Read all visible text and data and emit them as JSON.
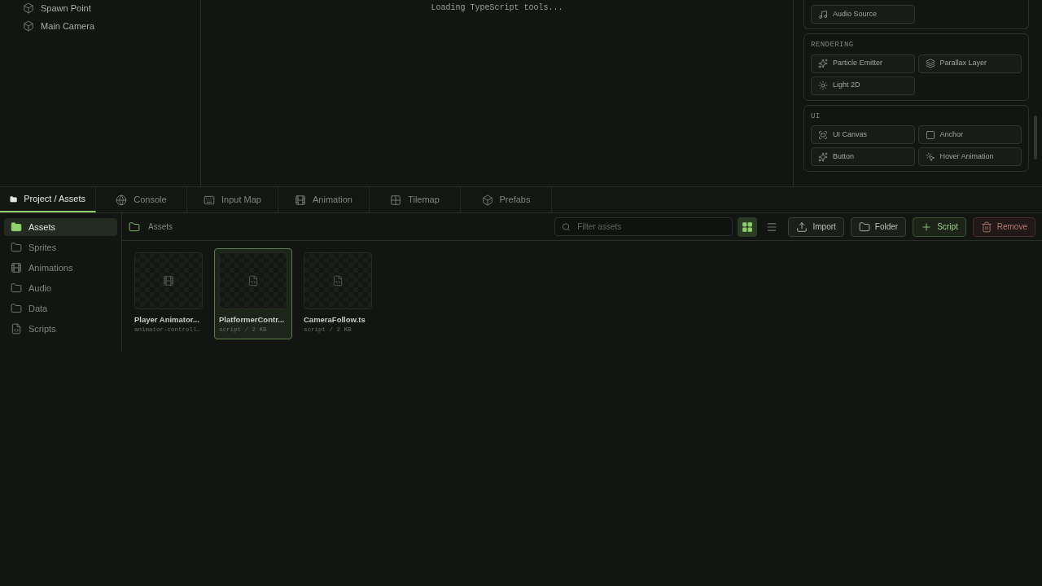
{
  "hierarchy": {
    "items": [
      "Spawn Point",
      "Main Camera"
    ]
  },
  "viewport": {
    "status": "Loading TypeScript tools..."
  },
  "components": {
    "sections": [
      {
        "items": [
          {
            "label": "Audio Source"
          }
        ]
      },
      {
        "title": "RENDERING",
        "items": [
          {
            "label": "Particle Emitter"
          },
          {
            "label": "Parallax Layer"
          },
          {
            "label": "Light 2D"
          }
        ]
      },
      {
        "title": "UI",
        "items": [
          {
            "label": "UI Canvas"
          },
          {
            "label": "Anchor"
          },
          {
            "label": "Button"
          },
          {
            "label": "Hover Animation"
          }
        ]
      }
    ]
  },
  "tabs": [
    {
      "label": "Project / Assets",
      "selected": true
    },
    {
      "label": "Console",
      "selected": false
    },
    {
      "label": "Input Map",
      "selected": false
    },
    {
      "label": "Animation",
      "selected": false
    },
    {
      "label": "Tilemap",
      "selected": false
    },
    {
      "label": "Prefabs",
      "selected": false
    }
  ],
  "folders": [
    {
      "label": "Assets",
      "selected": true
    },
    {
      "label": "Sprites",
      "selected": false
    },
    {
      "label": "Animations",
      "selected": false
    },
    {
      "label": "Audio",
      "selected": false
    },
    {
      "label": "Data",
      "selected": false
    },
    {
      "label": "Scripts",
      "selected": false
    }
  ],
  "breadcrumb": "Assets",
  "search": {
    "placeholder": "Filter assets"
  },
  "view_mode": {
    "grid_selected": true
  },
  "actions": [
    {
      "label": "Import",
      "kind": "normal"
    },
    {
      "label": "Folder",
      "kind": "normal"
    },
    {
      "label": "Script",
      "kind": "accent"
    },
    {
      "label": "Remove",
      "kind": "danger"
    }
  ],
  "assets": [
    {
      "name": "Player Animator...",
      "meta": "animator-controll…",
      "kind": "animator",
      "selected": false
    },
    {
      "name": "PlatformerContr...",
      "meta": "script / 2 KB",
      "kind": "script",
      "selected": true
    },
    {
      "name": "CameraFollow.ts",
      "meta": "script / 2 KB",
      "kind": "script",
      "selected": false
    }
  ]
}
